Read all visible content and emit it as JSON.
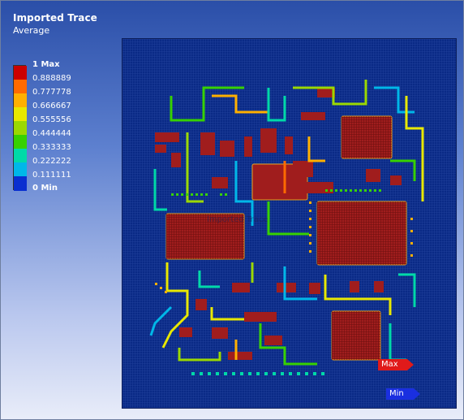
{
  "header": {
    "title": "Imported Trace",
    "subtitle": "Average"
  },
  "legend": {
    "labels": [
      "1 Max",
      "0.888889",
      "0.777778",
      "0.666667",
      "0.555556",
      "0.444444",
      "0.333333",
      "0.222222",
      "0.111111",
      "0 Min"
    ],
    "colors": [
      "#cc0000",
      "#ff6a00",
      "#ffb000",
      "#e8e800",
      "#9bd800",
      "#37d100",
      "#00d9a8",
      "#00b7e8",
      "#0b6fe6",
      "#0a2fd0"
    ]
  },
  "probes": {
    "max_label": "Max",
    "min_label": "Min"
  },
  "watermark": "Imported Trace",
  "colors": {
    "background_plot": "#0a2a86",
    "pad": "#a02020"
  }
}
